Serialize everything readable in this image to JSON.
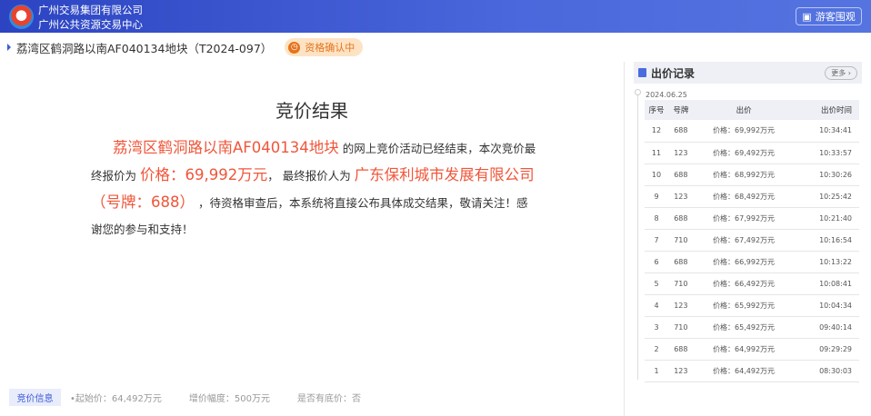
{
  "header": {
    "org_line1": "广州交易集团有限公司",
    "org_line2": "广州公共资源交易中心",
    "guest_button": "游客围观"
  },
  "project": {
    "title": "荔湾区鹤洞路以南AF040134地块（T2024-097）",
    "status_badge": "资格确认中"
  },
  "result": {
    "title": "竞价结果",
    "plot_name": "荔湾区鹤洞路以南AF040134地块",
    "text1": " 的网上竞价活动已经结束，本次竞价最终报价为 ",
    "final_price": "价格：69,992万元",
    "text2": "， 最终报价人为 ",
    "winner": "广东保利城市发展有限公司 （号牌：688）",
    "text3": " ，待资格审查后，本系统将直接公布具体成交结果，敬请关注！感谢您的参与和支持！"
  },
  "bid_info": {
    "tag": "竞价信息",
    "start_price": "起始价：64,492万元",
    "increment": "增价幅度：500万元",
    "reserve": "是否有底价：否"
  },
  "bid_records": {
    "title": "出价记录",
    "more": "更多",
    "date": "2024.06.25",
    "columns": [
      "序号",
      "号牌",
      "出价",
      "出价时间"
    ],
    "rows": [
      [
        "12",
        "688",
        "价格：69,992万元",
        "10:34:41"
      ],
      [
        "11",
        "123",
        "价格：69,492万元",
        "10:33:57"
      ],
      [
        "10",
        "688",
        "价格：68,992万元",
        "10:30:26"
      ],
      [
        "9",
        "123",
        "价格：68,492万元",
        "10:25:42"
      ],
      [
        "8",
        "688",
        "价格：67,992万元",
        "10:21:40"
      ],
      [
        "7",
        "710",
        "价格：67,492万元",
        "10:16:54"
      ],
      [
        "6",
        "688",
        "价格：66,992万元",
        "10:13:22"
      ],
      [
        "5",
        "710",
        "价格：66,492万元",
        "10:08:41"
      ],
      [
        "4",
        "123",
        "价格：65,992万元",
        "10:04:34"
      ],
      [
        "3",
        "710",
        "价格：65,492万元",
        "09:40:14"
      ],
      [
        "2",
        "688",
        "价格：64,992万元",
        "09:29:29"
      ],
      [
        "1",
        "123",
        "价格：64,492万元",
        "08:30:03"
      ]
    ]
  }
}
